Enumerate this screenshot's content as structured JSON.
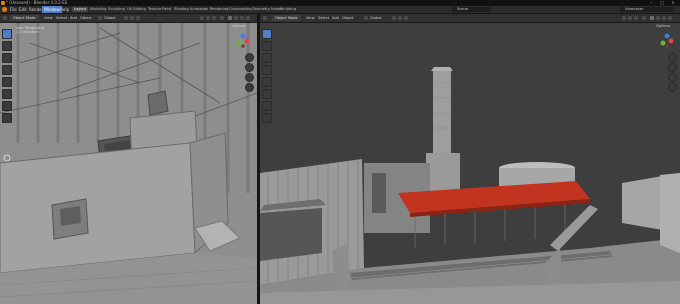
{
  "window": {
    "title": "* (Unsaved) - Blender 4.0.2-ES",
    "controls": [
      "–",
      "□",
      "×"
    ]
  },
  "menubar": {
    "items": [
      "File",
      "Edit",
      "Render",
      "Window",
      "Help"
    ],
    "highlighted": "Window"
  },
  "workspaces": {
    "tabs": [
      "Layout",
      "Modeling",
      "Sculpting",
      "UV Editing",
      "Texture Paint",
      "Shading",
      "Animation",
      "Rendering",
      "Compositing",
      "Geometry Nodes",
      "Scripting"
    ],
    "active": "Layout"
  },
  "scene": {
    "name": "Scene",
    "view_layer": "ViewLayer"
  },
  "left_viewport": {
    "mode": "Object Mode",
    "menus": [
      "View",
      "Select",
      "Add",
      "Object"
    ],
    "transform": "Global",
    "options_label": "Options",
    "overlay_text": [
      "User Perspective",
      "(1) Collection"
    ],
    "tools": [
      "cursor",
      "move",
      "rotate",
      "scale",
      "transform",
      "annotate",
      "measure",
      "add-cube"
    ],
    "active_tool": "cursor"
  },
  "right_viewport": {
    "mode": "Object Mode",
    "menus": [
      "View",
      "Select",
      "Add",
      "Object"
    ],
    "transform": "Global",
    "options_label": "Options",
    "tools": [
      "cursor",
      "move",
      "rotate",
      "scale",
      "transform",
      "annotate",
      "measure",
      "add-cube"
    ],
    "active_tool": "cursor"
  },
  "colors": {
    "accent": "#4f7fc7",
    "roof_red": "#c2341f",
    "sky": "#3f3f3f",
    "axis_x": "#e0453f",
    "axis_y": "#6fb33a",
    "axis_z": "#3f7be0"
  }
}
